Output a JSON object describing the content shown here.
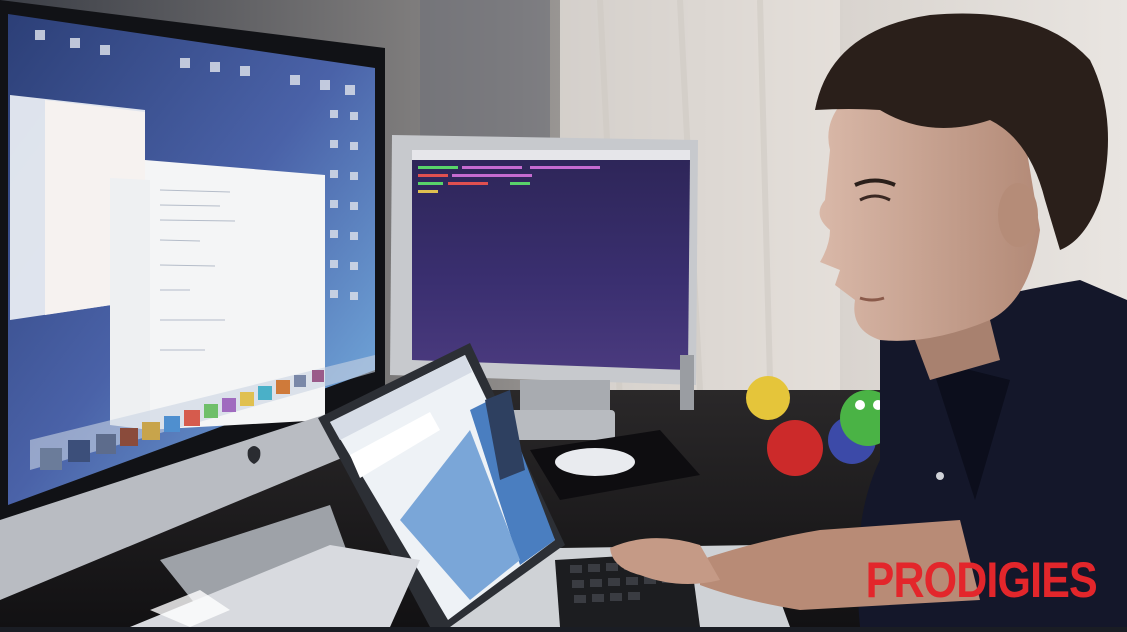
{
  "overlay": {
    "title": "PRODIGIES",
    "title_color": "#e3262b"
  },
  "scene": {
    "description_icons": [
      "imac-monitor",
      "secondary-monitor",
      "laptop",
      "mouse",
      "plush-toys",
      "boy"
    ],
    "colors": {
      "wall": "#c9c3bd",
      "curtain": "#e6e1dc",
      "desk": "#1b1a1c",
      "terminal_bg": "#3a2c6a",
      "laptop_screen": "#f2f4f6",
      "shirt": "#16182a"
    }
  }
}
